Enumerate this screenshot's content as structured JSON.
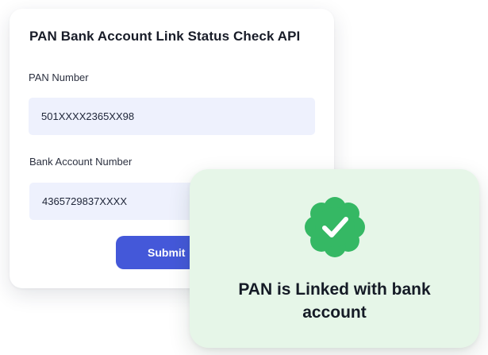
{
  "form": {
    "title": "PAN Bank Account Link Status Check API",
    "pan_label": "PAN Number",
    "pan_value": "501XXXX2365XX98",
    "bank_label": "Bank Account Number",
    "bank_value": "4365729837XXXX",
    "submit_label": "Submit"
  },
  "result": {
    "icon": "check-badge-icon",
    "message": "PAN is Linked with bank account",
    "accent_color": "#35b864",
    "background_color": "#e6f6e8"
  },
  "theme": {
    "primary": "#4458d9",
    "input_background": "#eef1fd",
    "text": "#181c28"
  }
}
